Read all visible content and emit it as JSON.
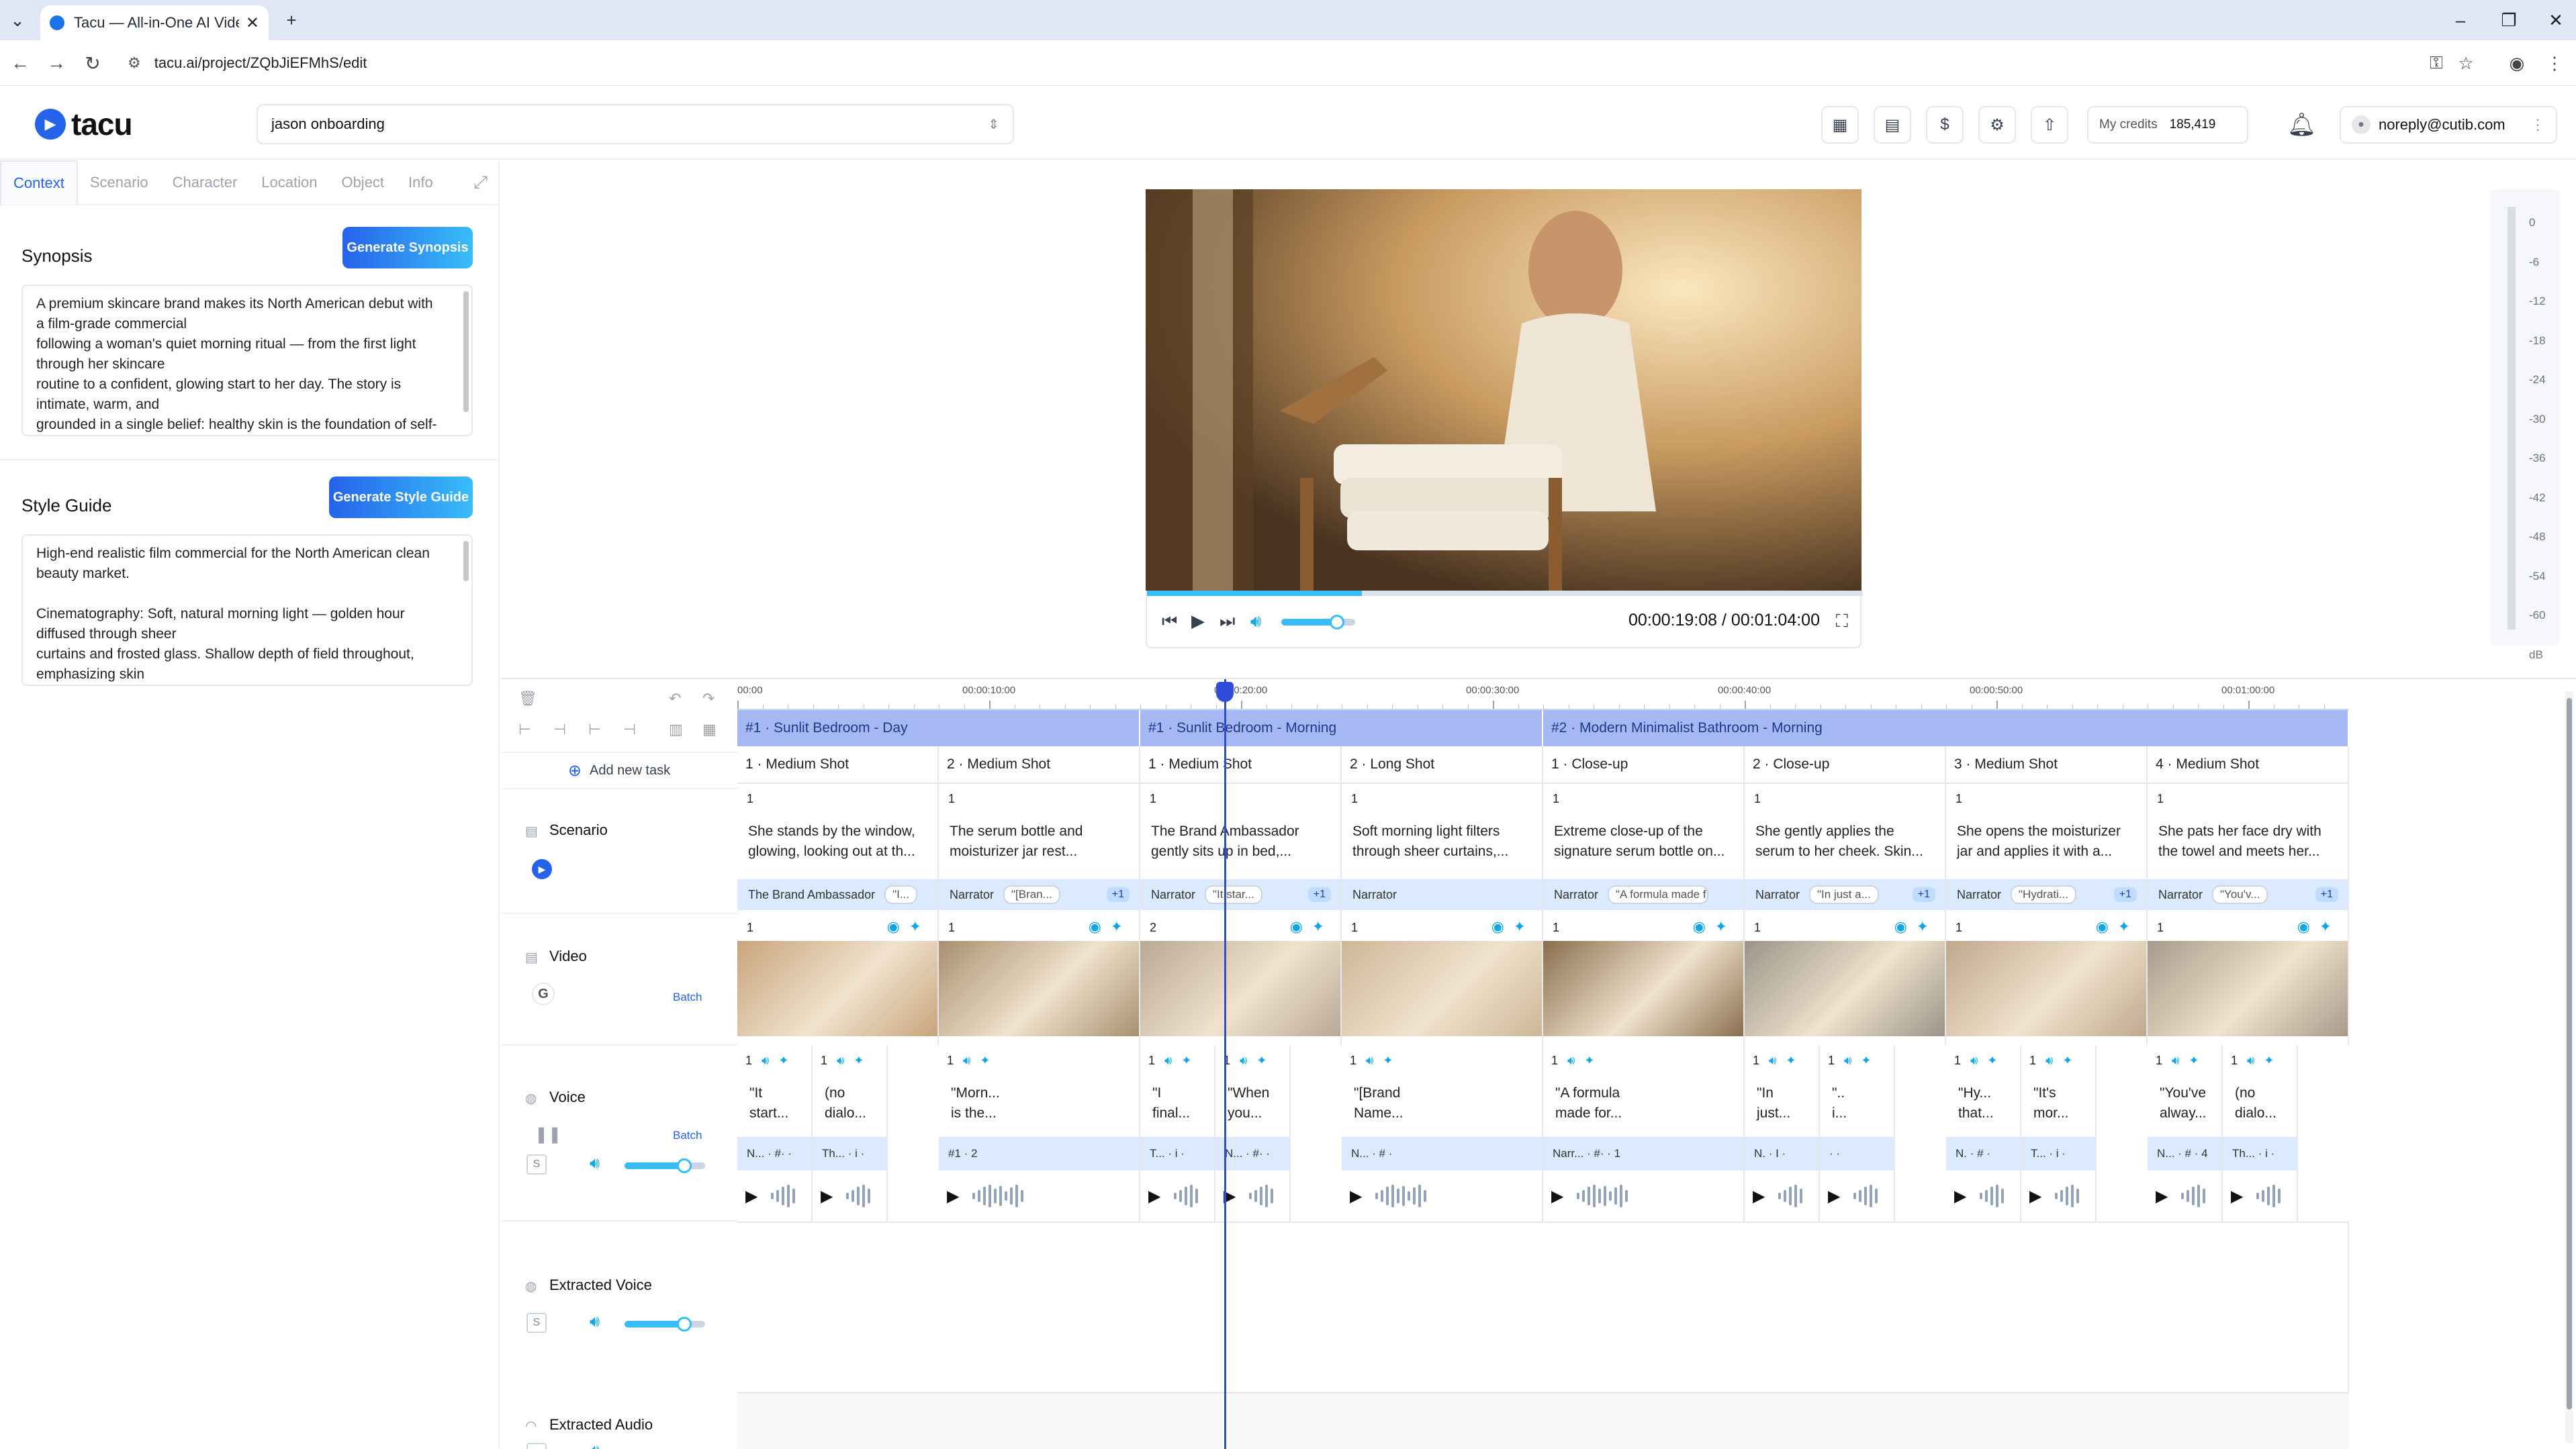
{
  "browser": {
    "tab_title": "Tacu — All-in-One AI Video P",
    "url": "tacu.ai/project/ZQbJiEFMhS/edit",
    "new_tab": "+",
    "tab_close": "✕",
    "min": "–",
    "max": "❐",
    "close": "✕"
  },
  "app": {
    "logo": "tacu",
    "project_name": "jason onboarding",
    "credits_label": "My credits",
    "credits_value": "185,419",
    "user_email": "noreply@cutib.com"
  },
  "left_panel": {
    "tabs": [
      "Context",
      "Scenario",
      "Character",
      "Location",
      "Object",
      "Info"
    ],
    "active_tab": "Context",
    "synopsis": {
      "title": "Synopsis",
      "button": "Generate Synopsis",
      "lines": [
        "A premium skincare brand makes its North American debut with",
        "a film-grade commercial",
        "following a woman's quiet morning ritual — from the first light",
        "through her skincare",
        "routine to a confident, glowing start to her day. The story is",
        "intimate, warm, and",
        "grounded in a single belief: healthy skin is the foundation of self-"
      ]
    },
    "style_guide": {
      "title": "Style Guide",
      "button": "Generate Style Guide",
      "lines": [
        "High-end realistic film commercial for the North American clean",
        "beauty market.",
        "",
        "Cinematography: Soft, natural morning light — golden hour",
        "diffused through sheer",
        "curtains and frosted glass. Shallow depth of field throughout,",
        "emphasizing skin"
      ]
    }
  },
  "player": {
    "timecode": "00:00:19:08 / 00:01:04:00",
    "progress": 0.3,
    "volume": 0.75,
    "db_labels": [
      "0",
      "-6",
      "-12",
      "-18",
      "-24",
      "-30",
      "-36",
      "-42",
      "-48",
      "-54",
      "-60",
      "dB"
    ]
  },
  "timeline": {
    "add_task": "Add new task",
    "ruler": [
      "00:00",
      "00:00:10:00",
      "00:00:20:00",
      "00:00:30:00",
      "00:00:40:00",
      "00:00:50:00",
      "00:01:00:00"
    ],
    "playhead_time": "00:00:19:08",
    "tracks": {
      "scenario": "Scenario",
      "video": "Video",
      "voice": "Voice",
      "extracted_voice": "Extracted Voice",
      "extracted_audio": "Extracted Audio",
      "batch": "Batch"
    },
    "scenes": [
      "#1 · Sunlit Bedroom - Day",
      "#1 · Sunlit Bedroom - Morning",
      "#2 · Modern Minimalist Bathroom - Morning"
    ],
    "shots": [
      {
        "label": "1 · Medium Shot",
        "num": "1",
        "desc1": "She stands by the window,",
        "desc2": "glowing, looking out at th...",
        "role": "The Brand Ambassador",
        "quote": "\"I...",
        "plus": "",
        "vnum": "1",
        "thumb": "#c8a47c"
      },
      {
        "label": "2 · Medium Shot",
        "num": "1",
        "desc1": "The serum bottle and",
        "desc2": "moisturizer jar rest...",
        "role": "Narrator",
        "quote": "\"[Bran...",
        "plus": "+1",
        "vnum": "1",
        "thumb": "#a89070"
      },
      {
        "label": "1 · Medium Shot",
        "num": "1",
        "desc1": "The Brand Ambassador",
        "desc2": "gently sits up in bed,...",
        "role": "Narrator",
        "quote": "\"It star...",
        "plus": "+1",
        "vnum": "2",
        "thumb": "#b9a893"
      },
      {
        "label": "2 · Long Shot",
        "num": "1",
        "desc1": "Soft morning light filters",
        "desc2": "through sheer curtains,...",
        "role": "Narrator",
        "quote": "",
        "plus": "",
        "vnum": "1",
        "thumb": "#cdb697"
      },
      {
        "label": "1 · Close-up",
        "num": "1",
        "desc1": "Extreme close-up of the",
        "desc2": "signature serum bottle on...",
        "role": "Narrator",
        "quote": "\"A formula made f...",
        "plus": "",
        "vnum": "1",
        "thumb": "#8a6e4e"
      },
      {
        "label": "2 · Close-up",
        "num": "1",
        "desc1": "She gently applies the",
        "desc2": "serum to her cheek. Skin...",
        "role": "Narrator",
        "quote": "\"In just a...",
        "plus": "+1",
        "vnum": "1",
        "thumb": "#9a9488"
      },
      {
        "label": "3 · Medium Shot",
        "num": "1",
        "desc1": "She opens the moisturizer",
        "desc2": "jar and applies it with a...",
        "role": "Narrator",
        "quote": "\"Hydrati...",
        "plus": "+1",
        "vnum": "1",
        "thumb": "#bfa88c"
      },
      {
        "label": "4 · Medium Shot",
        "num": "1",
        "desc1": "She pats her face dry with",
        "desc2": "the towel and meets her...",
        "role": "Narrator",
        "quote": "\"You'v...",
        "plus": "+1",
        "vnum": "1",
        "thumb": "#a9998a"
      }
    ],
    "voices": [
      {
        "num": "1",
        "t1": "\"It",
        "t2": "start...",
        "meta": "N... · #· ·"
      },
      {
        "num": "1",
        "t1": "(no",
        "t2": "dialo...",
        "meta": "Th... · i ·"
      },
      {
        "num": "1",
        "t1": "\"Morn...",
        "t2": "is the...",
        "meta": "#1 · 2"
      },
      {
        "num": "1",
        "t1": "\"I",
        "t2": "final...",
        "meta": "T... · i ·"
      },
      {
        "num": "1",
        "t1": "\"When",
        "t2": "you...",
        "meta": "N... · #· ·"
      },
      {
        "num": "1",
        "t1": "\"[Brand",
        "t2": "Name...",
        "meta": "N... · # ·"
      },
      {
        "num": "1",
        "t1": "\"A formula",
        "t2": "made for...",
        "meta": "Narr... · #· · 1"
      },
      {
        "num": "1",
        "t1": "\"In",
        "t2": "just...",
        "meta": "N. · I ·"
      },
      {
        "num": "1",
        "t1": "\"..",
        "t2": "i...",
        "meta": "· ·"
      },
      {
        "num": "1",
        "t1": "\"Hy...",
        "t2": "that...",
        "meta": "N. · # ·"
      },
      {
        "num": "1",
        "t1": "\"It's",
        "t2": "mor...",
        "meta": "T... · i ·"
      },
      {
        "num": "1",
        "t1": "\"You've",
        "t2": "alway...",
        "meta": "N... · # · 4"
      },
      {
        "num": "1",
        "t1": "(no",
        "t2": "dialo...",
        "meta": "Th... · i ·"
      }
    ]
  }
}
